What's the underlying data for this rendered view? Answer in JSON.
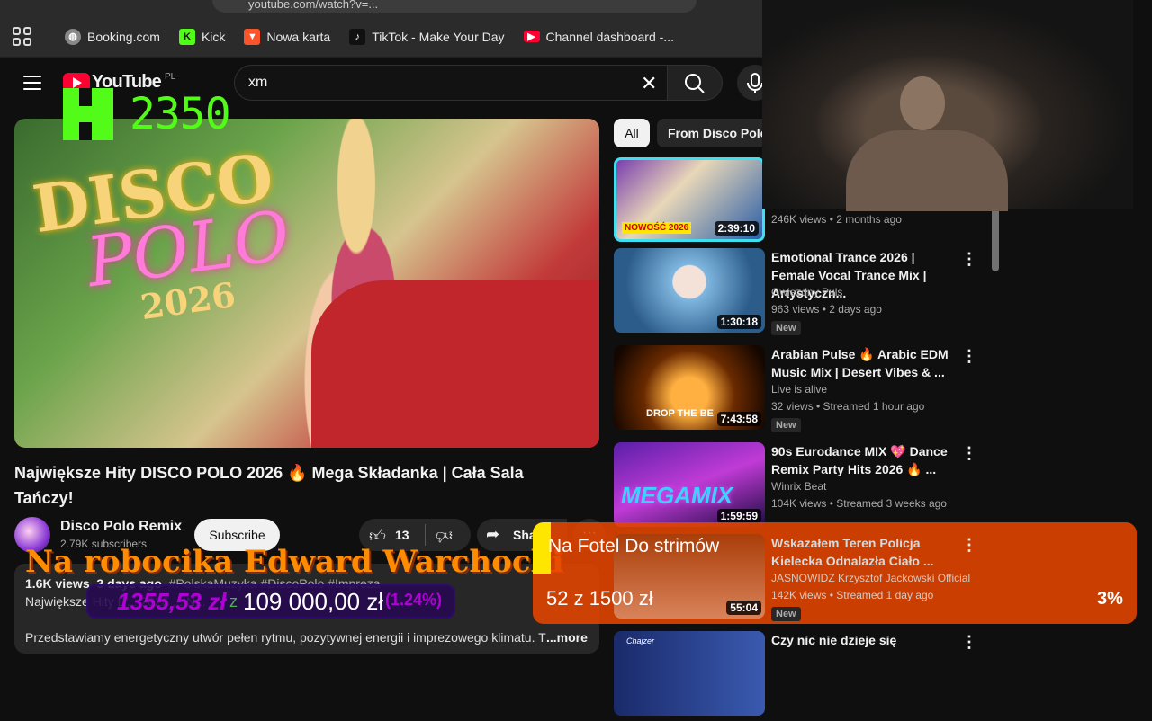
{
  "browser": {
    "address": "youtube.com/watch?v=...",
    "bookmarks": [
      {
        "label": "Booking.com",
        "icon": "globe-icon",
        "color": "#888888"
      },
      {
        "label": "Kick",
        "icon": "kick-icon",
        "color": "#53fc18"
      },
      {
        "label": "Nowa karta",
        "icon": "brave-icon",
        "color": "#fb542b"
      },
      {
        "label": "TikTok - Make Your Day",
        "icon": "tiktok-icon",
        "color": "#111111"
      },
      {
        "label": "Channel dashboard -...",
        "icon": "youtube-icon",
        "color": "#ff0033"
      }
    ]
  },
  "header": {
    "logo": "YouTube",
    "country": "PL",
    "search_value": "xm"
  },
  "kick_overlay": {
    "count": "2350"
  },
  "player": {
    "thumb_line1": "DISCO",
    "thumb_line2": "POLO",
    "thumb_line3": "2026"
  },
  "video": {
    "title": "Największe Hity DISCO POLO 2026 🔥 Mega Składanka | Cała Sala Tańczy!",
    "channel": "Disco Polo Remix",
    "subscribers": "2.79K subscribers",
    "subscribe_label": "Subscribe",
    "likes": "13",
    "share_label": "Sha",
    "meta_views": "1.6K views",
    "meta_date": "3 days ago",
    "meta_tags": "#PolskaMuzyka #DiscoPolo #Impreza",
    "desc_line2": "Największe Hity D... 2026 ... N...",
    "desc_line3": "Przedstawiamy energetyczny utwór pełen rytmu, pozytywnej energii i imprezowego klimatu. T",
    "more_label": "...more"
  },
  "chips": {
    "all": "All",
    "from": "From Disco Polo"
  },
  "recommendations": [
    {
      "title": "",
      "channel": "",
      "views": "246K views • 2 months ago",
      "duration": "2:39:10",
      "new": "",
      "badge": "NOWOŚĆ 2026"
    },
    {
      "title": "Emotional Trance 2026 | Female Vocal Trance Mix | Artystyczn...",
      "channel": "Gwiezdny Puls",
      "views": "963 views • 2 days ago",
      "duration": "1:30:18",
      "new": "New"
    },
    {
      "title": "Arabian Pulse 🔥 Arabic EDM Music Mix | Desert Vibes & ...",
      "channel": "Live is alive",
      "views": "32 views • Streamed 1 hour ago",
      "duration": "7:43:58",
      "new": "New",
      "thumb_text": "DROP THE BE"
    },
    {
      "title": "90s Eurodance MIX 💖 Dance Remix Party Hits 2026 🔥 ...",
      "channel": "Winrix Beat",
      "views": "104K views • Streamed 3 weeks ago",
      "duration": "1:59:59",
      "new": "",
      "thumb_text": "MEGAMIX"
    },
    {
      "title": "Wskazałem Teren Policja Kielecka Odnalazła Ciało ...",
      "channel": "JASNOWIDZ Krzysztof Jackowski Official",
      "views": "142K views • Streamed 1 day ago",
      "duration": "55:04",
      "new": "New"
    },
    {
      "title": "Czy nic nie dzieje się",
      "channel": "",
      "views": "",
      "duration": "",
      "new": "",
      "thumb_text": "Chajzer"
    }
  ],
  "overlay": {
    "robot_title": "Na robocika Edward Warchocki",
    "raised": "1355,53 zł",
    "separator": "z",
    "goal": "109 000,00 zł",
    "percent": "(1.24%)"
  },
  "stream_goal": {
    "title": "Na Fotel Do strimów",
    "progress": "52 z 1500 zł",
    "percent": "3%"
  },
  "colors": {
    "kick_green": "#53fc18",
    "yt_red": "#ff0033",
    "goal_orange": "#e64600"
  }
}
